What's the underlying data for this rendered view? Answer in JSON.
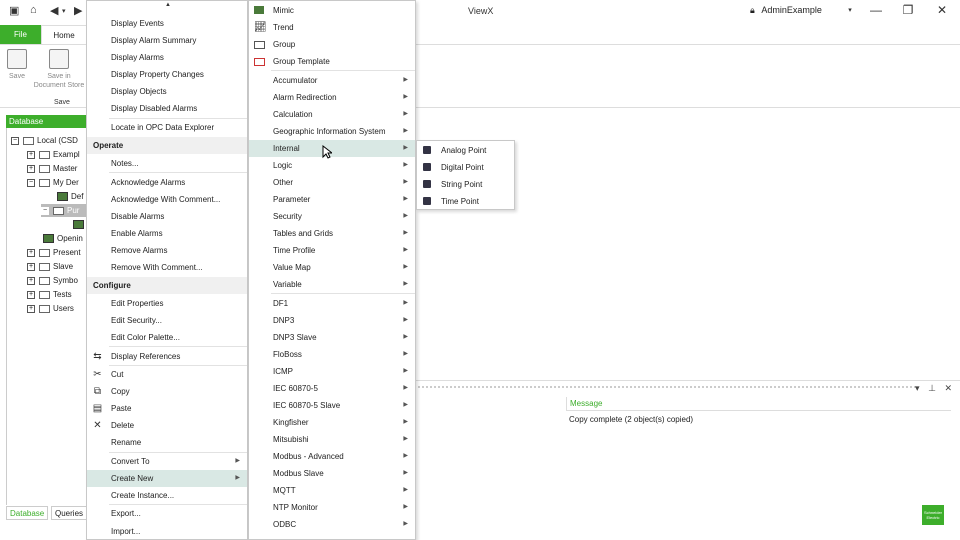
{
  "titlebar": {
    "title": "ViewX",
    "user": "AdminExample",
    "minimize": "—",
    "restore": "❐",
    "close": "✕"
  },
  "ribbon": {
    "tab_file": "File",
    "tab_home": "Home",
    "save": "Save",
    "save_in_doc": "Save in Document Store",
    "group_save": "Save"
  },
  "database": {
    "header": "Database",
    "tree": [
      {
        "label": "Local (CSD",
        "exp": "⊟"
      },
      {
        "label": "Exampl",
        "exp": "+"
      },
      {
        "label": "Master",
        "exp": "+"
      },
      {
        "label": "My Der",
        "exp": "−"
      },
      {
        "label": "Def"
      },
      {
        "label": "Pur",
        "exp": "−"
      },
      {
        "label": ""
      },
      {
        "label": "Openin"
      },
      {
        "label": "Present",
        "exp": "+"
      },
      {
        "label": "Slave",
        "exp": "+"
      },
      {
        "label": "Symbo",
        "exp": "+"
      },
      {
        "label": "Tests",
        "exp": "+"
      },
      {
        "label": "Users",
        "exp": "+"
      }
    ],
    "tab_database": "Database",
    "tab_queries": "Queries"
  },
  "messages": {
    "header": "Message",
    "row": "Copy complete (2 object(s) copied)"
  },
  "menu1": {
    "items": [
      "Display Events",
      "Display Alarm Summary",
      "Display Alarms",
      "Display Property Changes",
      "Display Objects",
      "Display Disabled Alarms",
      "Locate in OPC Data Explorer"
    ],
    "sec_operate": "Operate",
    "operate": [
      "Notes...",
      "Acknowledge Alarms",
      "Acknowledge With Comment...",
      "Disable Alarms",
      "Enable Alarms",
      "Remove Alarms",
      "Remove With Comment..."
    ],
    "sec_configure": "Configure",
    "configure": [
      "Edit Properties",
      "Edit Security...",
      "Edit Color Palette...",
      "Display References",
      "Cut",
      "Copy",
      "Paste",
      "Delete",
      "Rename",
      "Convert To",
      "Create New",
      "Create Instance...",
      "Export...",
      "Import..."
    ]
  },
  "menu2": {
    "items": [
      "Mimic",
      "Trend",
      "Group",
      "Group Template",
      "Accumulator",
      "Alarm Redirection",
      "Calculation",
      "Geographic Information System",
      "Internal",
      "Logic",
      "Other",
      "Parameter",
      "Security",
      "Tables and Grids",
      "Time Profile",
      "Value Map",
      "Variable",
      "DF1",
      "DNP3",
      "DNP3 Slave",
      "FloBoss",
      "ICMP",
      "IEC 60870-5",
      "IEC 60870-5 Slave",
      "Kingfisher",
      "Mitsubishi",
      "Modbus - Advanced",
      "Modbus Slave",
      "MQTT",
      "NTP Monitor",
      "ODBC"
    ]
  },
  "menu3": {
    "items": [
      "Analog Point",
      "Digital Point",
      "String Point",
      "Time Point"
    ]
  },
  "colors": {
    "accent": "#3dae2b",
    "highlight": "#d9e8e4"
  }
}
